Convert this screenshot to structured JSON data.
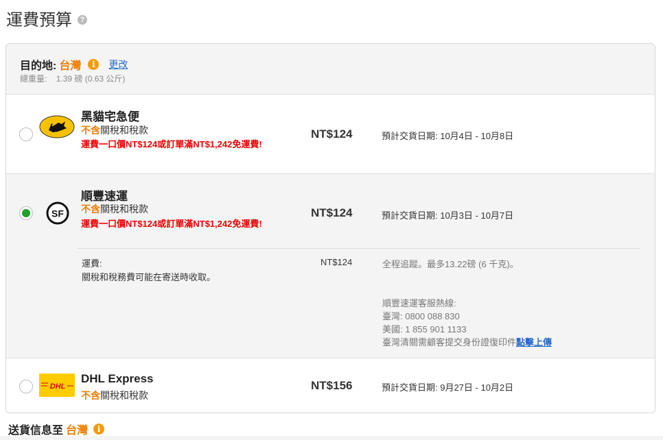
{
  "page_title": "運費預算",
  "destination": {
    "label": "目的地:",
    "country": "台灣",
    "change_link": "更改",
    "weight_label": "總重量:",
    "weight_value": "1.39 磅 (0.63 公斤)"
  },
  "options": [
    {
      "name": "黑貓宅急便",
      "tax_excl": "不含",
      "tax_text": "關稅和稅款",
      "promo": "運費一口價NT$124或訂單滿NT$1,242免運費!",
      "price": "NT$124",
      "eta": "預計交貨日期: 10月4日 - 10月8日",
      "selected": false,
      "logo_icon": "black-cat-logo"
    },
    {
      "name": "順豐速運",
      "tax_excl": "不含",
      "tax_text": "關稅和稅款",
      "promo": "運費一口價NT$124或訂單滿NT$1,242免運費!",
      "price": "NT$124",
      "eta": "預計交貨日期: 10月3日 - 10月7日",
      "selected": true,
      "logo_icon": "sf-express-logo",
      "logo_text": "SF",
      "details": {
        "fee_label": "運費:",
        "duty_note": "關稅和稅務費可能在寄送時收取。",
        "fee_amount": "NT$124",
        "tracking": "全程追蹤。最多13.22磅 (6 千克)。",
        "hotline_title": "順豐速運客服熱線:",
        "hotline_tw": "臺灣: 0800 088 830",
        "hotline_us": "美國: 1 855 901 1133",
        "customs_note": "臺灣清關需顧客提交身份證復印件",
        "upload_link": "點擊上傳"
      }
    },
    {
      "name": "DHL Express",
      "tax_excl": "不含",
      "tax_text": "關稅和稅款",
      "price": "NT$156",
      "eta": "預計交貨日期: 9月27日 - 10月2日",
      "selected": false,
      "logo_icon": "dhl-logo",
      "logo_text": "DHL"
    }
  ],
  "shipping_info": {
    "label": "送貨信息至",
    "country": "台灣"
  },
  "colors": {
    "accent_orange": "#f07d00",
    "promo_red": "#e00000",
    "selected_green": "#1ea32c",
    "link_blue": "#2369c8"
  }
}
